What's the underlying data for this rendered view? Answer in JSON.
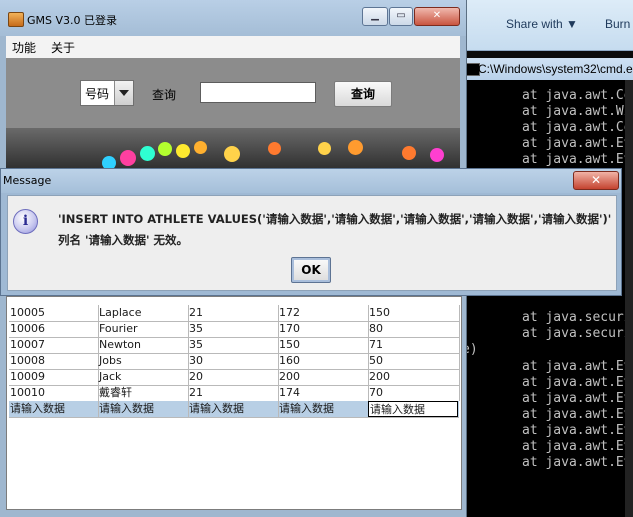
{
  "explorer": {
    "share_label": "Share with ▼",
    "burn_label": "Burn"
  },
  "cmd": {
    "title": "C:\\Windows\\system32\\cmd.e",
    "lines_top": [
      "at java.awt.Co",
      "at java.awt.Wi",
      "at java.awt.Co",
      "at java.awt.Ev",
      "at java.awt.Ev"
    ],
    "lines_mid": [
      "at java.securi",
      "at java.securi",
      "e)"
    ],
    "lines_bottom": [
      "at java.awt.Ev",
      "at java.awt.Ev",
      "at java.awt.Ev",
      "at java.awt.Ev",
      "at java.awt.Ev",
      "at java.awt.Ev",
      "at java.awt.Ev"
    ]
  },
  "gms": {
    "title": "GMS V3.0  已登录",
    "menu": [
      "功能",
      "关于"
    ],
    "search": {
      "combo_value": "号码",
      "label": "查询",
      "input_value": "",
      "button_label": "查询"
    }
  },
  "dialog": {
    "title": "Message",
    "close_label": "✕",
    "line1": "'INSERT INTO ATHLETE VALUES('请输入数据','请输入数据','请输入数据','请输入数据','请输入数据')'",
    "line2": "列名 '请输入数据' 无效。",
    "ok_label": "OK"
  },
  "table": {
    "rows": [
      [
        "10005",
        "Laplace",
        "21",
        "172",
        "150"
      ],
      [
        "10006",
        "Fourier",
        "35",
        "170",
        "80"
      ],
      [
        "10007",
        "Newton",
        "35",
        "150",
        "71"
      ],
      [
        "10008",
        "Jobs",
        "30",
        "160",
        "50"
      ],
      [
        "10009",
        "Jack",
        "20",
        "200",
        "200"
      ],
      [
        "10010",
        "戴睿轩",
        "21",
        "174",
        "70"
      ],
      [
        "请输入数据",
        "请输入数据",
        "请输入数据",
        "请输入数据",
        "请输入数据"
      ]
    ]
  },
  "colors": {
    "selected_row": "#b8cfe5",
    "cmd_text": "#c0c0c0",
    "title_blue": "#a4bdd6"
  }
}
